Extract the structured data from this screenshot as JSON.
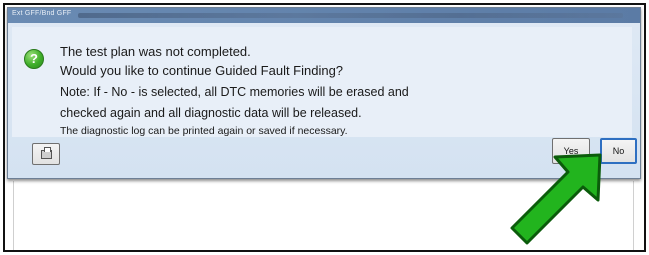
{
  "dialog": {
    "title": "Ext GFF/Bnd GFF",
    "message_lines": [
      "The test plan was not completed.",
      "Would you like to continue Guided Fault Finding?",
      "Note: If - No - is selected, all DTC memories will be erased and",
      "checked again and all diagnostic data will be released.",
      "The diagnostic log can be printed again or saved if necessary."
    ],
    "icon": "question-icon",
    "print_icon": "printer-icon",
    "buttons": {
      "yes": "Yes",
      "no": "No"
    }
  },
  "annotation": {
    "icon": "green-arrow-icon",
    "color": "#22b41e"
  }
}
